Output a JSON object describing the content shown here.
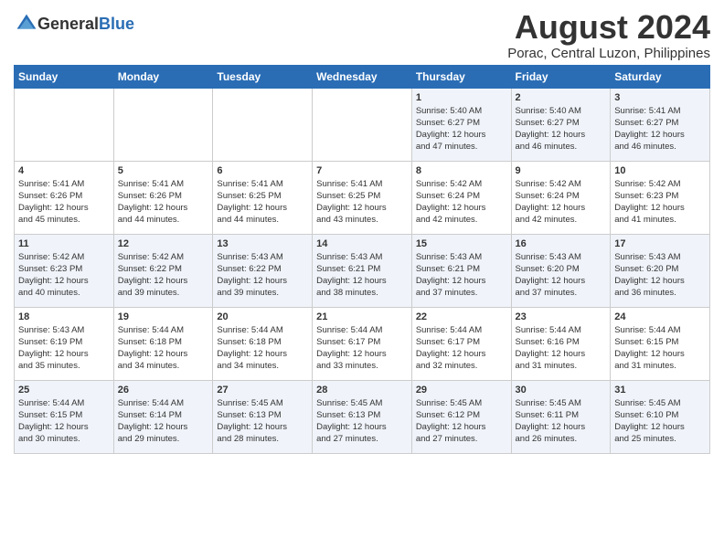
{
  "header": {
    "logo_general": "General",
    "logo_blue": "Blue",
    "main_title": "August 2024",
    "sub_title": "Porac, Central Luzon, Philippines"
  },
  "days_of_week": [
    "Sunday",
    "Monday",
    "Tuesday",
    "Wednesday",
    "Thursday",
    "Friday",
    "Saturday"
  ],
  "weeks": [
    [
      {
        "day": "",
        "content": ""
      },
      {
        "day": "",
        "content": ""
      },
      {
        "day": "",
        "content": ""
      },
      {
        "day": "",
        "content": ""
      },
      {
        "day": "1",
        "content": "Sunrise: 5:40 AM\nSunset: 6:27 PM\nDaylight: 12 hours\nand 47 minutes."
      },
      {
        "day": "2",
        "content": "Sunrise: 5:40 AM\nSunset: 6:27 PM\nDaylight: 12 hours\nand 46 minutes."
      },
      {
        "day": "3",
        "content": "Sunrise: 5:41 AM\nSunset: 6:27 PM\nDaylight: 12 hours\nand 46 minutes."
      }
    ],
    [
      {
        "day": "4",
        "content": "Sunrise: 5:41 AM\nSunset: 6:26 PM\nDaylight: 12 hours\nand 45 minutes."
      },
      {
        "day": "5",
        "content": "Sunrise: 5:41 AM\nSunset: 6:26 PM\nDaylight: 12 hours\nand 44 minutes."
      },
      {
        "day": "6",
        "content": "Sunrise: 5:41 AM\nSunset: 6:25 PM\nDaylight: 12 hours\nand 44 minutes."
      },
      {
        "day": "7",
        "content": "Sunrise: 5:41 AM\nSunset: 6:25 PM\nDaylight: 12 hours\nand 43 minutes."
      },
      {
        "day": "8",
        "content": "Sunrise: 5:42 AM\nSunset: 6:24 PM\nDaylight: 12 hours\nand 42 minutes."
      },
      {
        "day": "9",
        "content": "Sunrise: 5:42 AM\nSunset: 6:24 PM\nDaylight: 12 hours\nand 42 minutes."
      },
      {
        "day": "10",
        "content": "Sunrise: 5:42 AM\nSunset: 6:23 PM\nDaylight: 12 hours\nand 41 minutes."
      }
    ],
    [
      {
        "day": "11",
        "content": "Sunrise: 5:42 AM\nSunset: 6:23 PM\nDaylight: 12 hours\nand 40 minutes."
      },
      {
        "day": "12",
        "content": "Sunrise: 5:42 AM\nSunset: 6:22 PM\nDaylight: 12 hours\nand 39 minutes."
      },
      {
        "day": "13",
        "content": "Sunrise: 5:43 AM\nSunset: 6:22 PM\nDaylight: 12 hours\nand 39 minutes."
      },
      {
        "day": "14",
        "content": "Sunrise: 5:43 AM\nSunset: 6:21 PM\nDaylight: 12 hours\nand 38 minutes."
      },
      {
        "day": "15",
        "content": "Sunrise: 5:43 AM\nSunset: 6:21 PM\nDaylight: 12 hours\nand 37 minutes."
      },
      {
        "day": "16",
        "content": "Sunrise: 5:43 AM\nSunset: 6:20 PM\nDaylight: 12 hours\nand 37 minutes."
      },
      {
        "day": "17",
        "content": "Sunrise: 5:43 AM\nSunset: 6:20 PM\nDaylight: 12 hours\nand 36 minutes."
      }
    ],
    [
      {
        "day": "18",
        "content": "Sunrise: 5:43 AM\nSunset: 6:19 PM\nDaylight: 12 hours\nand 35 minutes."
      },
      {
        "day": "19",
        "content": "Sunrise: 5:44 AM\nSunset: 6:18 PM\nDaylight: 12 hours\nand 34 minutes."
      },
      {
        "day": "20",
        "content": "Sunrise: 5:44 AM\nSunset: 6:18 PM\nDaylight: 12 hours\nand 34 minutes."
      },
      {
        "day": "21",
        "content": "Sunrise: 5:44 AM\nSunset: 6:17 PM\nDaylight: 12 hours\nand 33 minutes."
      },
      {
        "day": "22",
        "content": "Sunrise: 5:44 AM\nSunset: 6:17 PM\nDaylight: 12 hours\nand 32 minutes."
      },
      {
        "day": "23",
        "content": "Sunrise: 5:44 AM\nSunset: 6:16 PM\nDaylight: 12 hours\nand 31 minutes."
      },
      {
        "day": "24",
        "content": "Sunrise: 5:44 AM\nSunset: 6:15 PM\nDaylight: 12 hours\nand 31 minutes."
      }
    ],
    [
      {
        "day": "25",
        "content": "Sunrise: 5:44 AM\nSunset: 6:15 PM\nDaylight: 12 hours\nand 30 minutes."
      },
      {
        "day": "26",
        "content": "Sunrise: 5:44 AM\nSunset: 6:14 PM\nDaylight: 12 hours\nand 29 minutes."
      },
      {
        "day": "27",
        "content": "Sunrise: 5:45 AM\nSunset: 6:13 PM\nDaylight: 12 hours\nand 28 minutes."
      },
      {
        "day": "28",
        "content": "Sunrise: 5:45 AM\nSunset: 6:13 PM\nDaylight: 12 hours\nand 27 minutes."
      },
      {
        "day": "29",
        "content": "Sunrise: 5:45 AM\nSunset: 6:12 PM\nDaylight: 12 hours\nand 27 minutes."
      },
      {
        "day": "30",
        "content": "Sunrise: 5:45 AM\nSunset: 6:11 PM\nDaylight: 12 hours\nand 26 minutes."
      },
      {
        "day": "31",
        "content": "Sunrise: 5:45 AM\nSunset: 6:10 PM\nDaylight: 12 hours\nand 25 minutes."
      }
    ]
  ]
}
